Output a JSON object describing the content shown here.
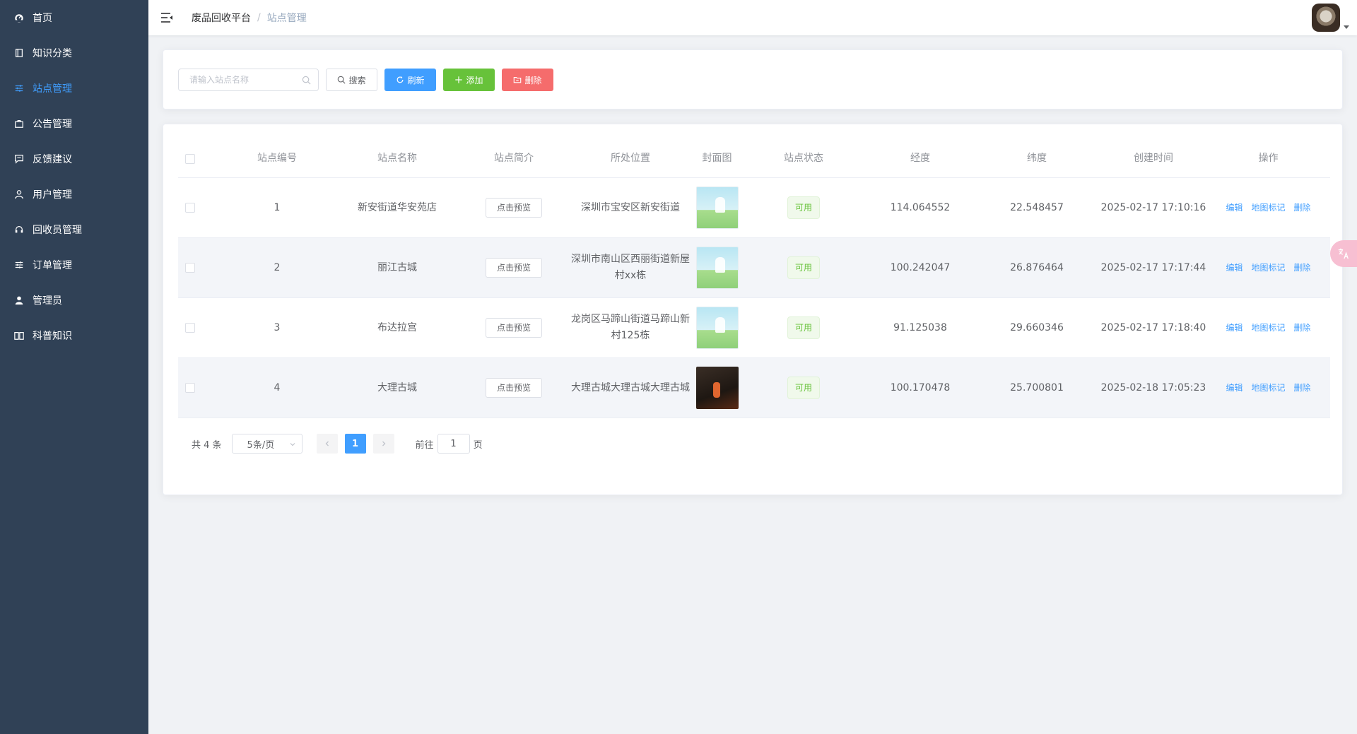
{
  "sidebar": {
    "items": [
      {
        "label": "首页",
        "icon": "dashboard-icon",
        "active": false
      },
      {
        "label": "知识分类",
        "icon": "book-icon",
        "active": false
      },
      {
        "label": "站点管理",
        "icon": "sliders-icon",
        "active": true
      },
      {
        "label": "公告管理",
        "icon": "briefcase-icon",
        "active": false
      },
      {
        "label": "反馈建议",
        "icon": "message-icon",
        "active": false
      },
      {
        "label": "用户管理",
        "icon": "user-icon",
        "active": false
      },
      {
        "label": "回收员管理",
        "icon": "headset-icon",
        "active": false
      },
      {
        "label": "订单管理",
        "icon": "sliders-icon",
        "active": false
      },
      {
        "label": "管理员",
        "icon": "person-icon",
        "active": false
      },
      {
        "label": "科普知识",
        "icon": "open-book-icon",
        "active": false
      }
    ]
  },
  "header": {
    "breadcrumb": [
      "废品回收平台",
      "站点管理"
    ],
    "separator": "/"
  },
  "toolbar": {
    "search_placeholder": "请输入站点名称",
    "search_label": "搜索",
    "refresh_label": "刷新",
    "add_label": "添加",
    "delete_label": "删除"
  },
  "table": {
    "columns": [
      "站点编号",
      "站点名称",
      "站点简介",
      "所处位置",
      "封面图",
      "站点状态",
      "经度",
      "纬度",
      "创建时间",
      "操作"
    ],
    "rows": [
      {
        "id": "1",
        "name": "新安街道华安苑店",
        "intro": "点击预览",
        "location": "深圳市宝安区新安街道",
        "cover": "light",
        "status": "可用",
        "lng": "114.064552",
        "lat": "22.548457",
        "created": "2025-02-17 17:10:16"
      },
      {
        "id": "2",
        "name": "丽江古城",
        "intro": "点击预览",
        "location": "深圳市南山区西丽街道新屋村xx栋",
        "cover": "light",
        "status": "可用",
        "lng": "100.242047",
        "lat": "26.876464",
        "created": "2025-02-17 17:17:44"
      },
      {
        "id": "3",
        "name": "布达拉宫",
        "intro": "点击预览",
        "location": "龙岗区马蹄山街道马蹄山新村125栋",
        "cover": "light",
        "status": "可用",
        "lng": "91.125038",
        "lat": "29.660346",
        "created": "2025-02-17 17:18:40"
      },
      {
        "id": "4",
        "name": "大理古城",
        "intro": "点击预览",
        "location": "大理古城大理古城大理古城",
        "cover": "dark",
        "status": "可用",
        "lng": "100.170478",
        "lat": "25.700801",
        "created": "2025-02-18 17:05:23"
      }
    ],
    "actions": [
      "编辑",
      "地图标记",
      "删除"
    ]
  },
  "pagination": {
    "total_text": "共 4 条",
    "page_size": "5条/页",
    "current_page": "1",
    "goto_prefix": "前往",
    "goto_value": "1",
    "goto_suffix": "页"
  },
  "colors": {
    "sidebar_bg": "#304156",
    "primary": "#409eff",
    "success": "#67c23a",
    "danger": "#f56c6c"
  }
}
